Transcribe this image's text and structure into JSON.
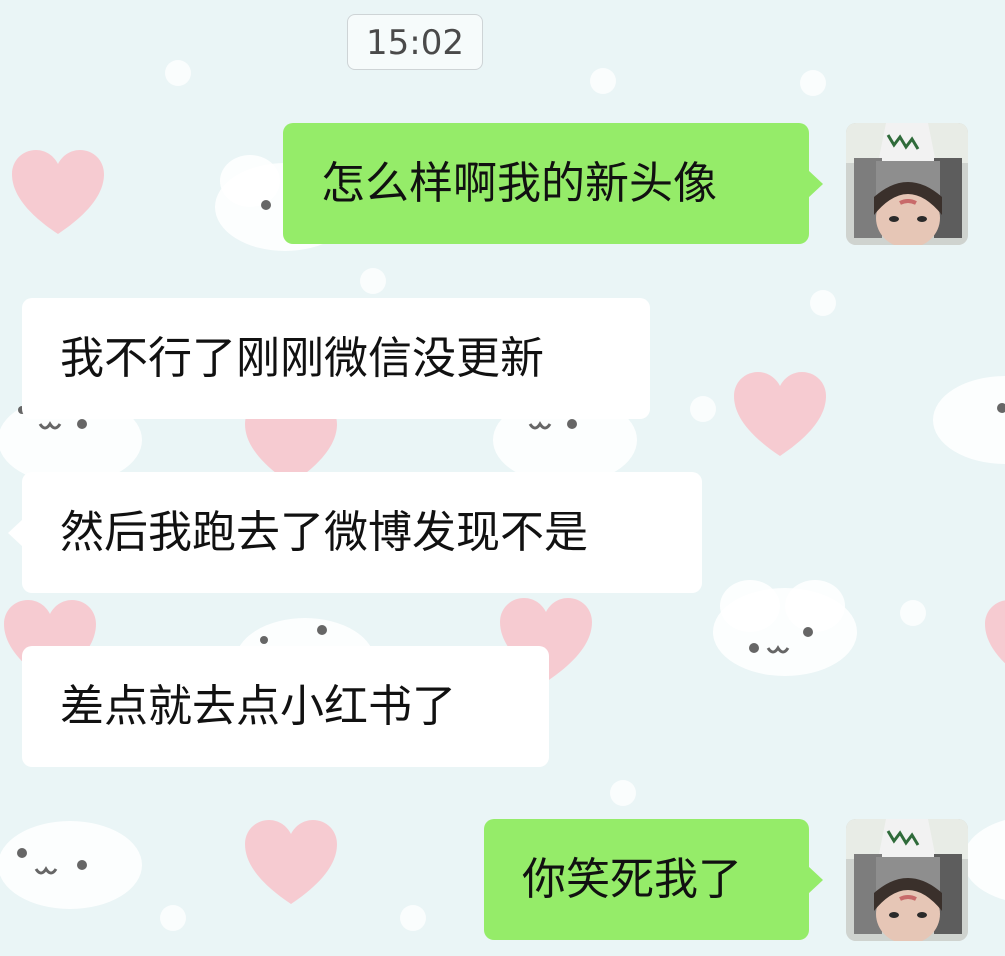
{
  "chat": {
    "timestamp": "15:02",
    "messages": [
      {
        "side": "out",
        "text": "怎么样啊我的新头像",
        "has_avatar": true
      },
      {
        "side": "in",
        "text": "我不行了刚刚微信没更新"
      },
      {
        "side": "in",
        "text": "然后我跑去了微博发现不是"
      },
      {
        "side": "in",
        "text": "差点就去点小红书了"
      },
      {
        "side": "out",
        "text": "你笑死我了",
        "has_avatar": true
      }
    ]
  },
  "theme": {
    "background": "#eaf5f6",
    "outgoing_bubble": "#95ec69",
    "incoming_bubble": "#ffffff",
    "heart_color": "#f7c6cd"
  },
  "icons": {
    "avatar": "user-avatar-photo"
  }
}
